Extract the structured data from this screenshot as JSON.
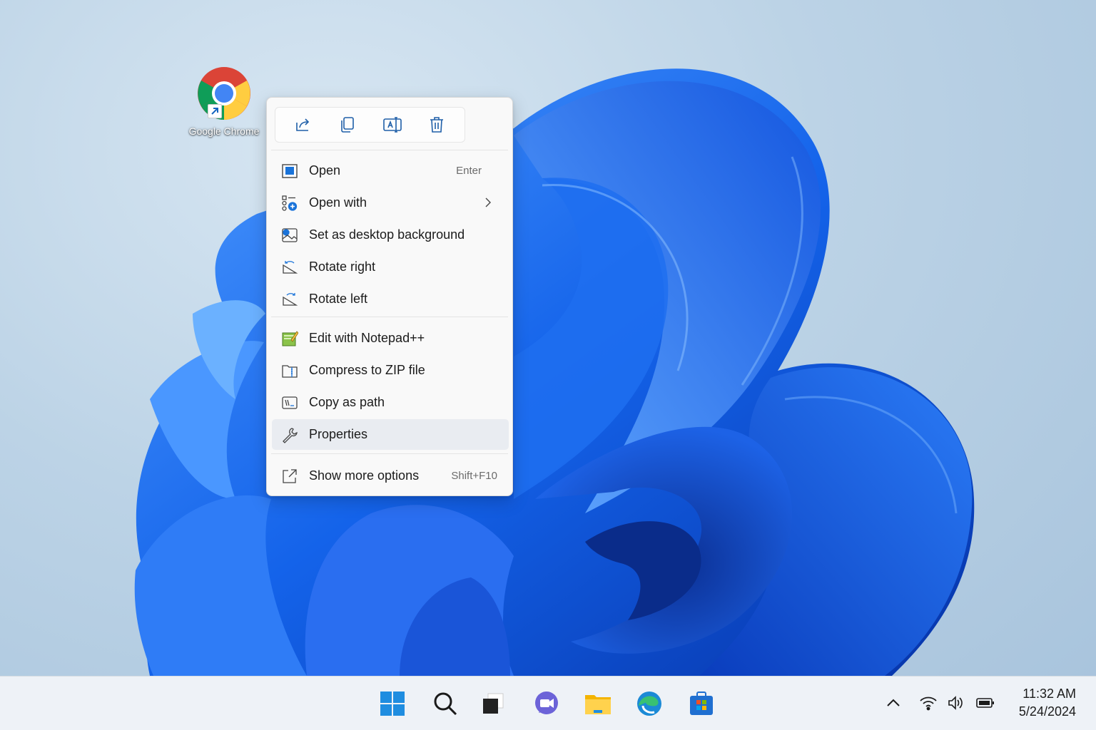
{
  "desktop": {
    "icons": [
      {
        "label": "Google Chrome"
      }
    ]
  },
  "context_menu": {
    "toolbar": [
      {
        "name": "share",
        "icon": "share-icon"
      },
      {
        "name": "copy",
        "icon": "copy-icon"
      },
      {
        "name": "rename",
        "icon": "rename-icon"
      },
      {
        "name": "delete",
        "icon": "trash-icon"
      }
    ],
    "items": [
      {
        "label": "Open",
        "shortcut": "Enter",
        "icon": "open-window-icon"
      },
      {
        "label": "Open with",
        "icon": "open-with-icon",
        "submenu": true
      },
      {
        "label": "Set as desktop background",
        "icon": "image-icon"
      },
      {
        "label": "Rotate right",
        "icon": "rotate-right-icon"
      },
      {
        "label": "Rotate left",
        "icon": "rotate-left-icon"
      },
      {
        "label": "Edit with Notepad++",
        "icon": "notepadpp-icon"
      },
      {
        "label": "Compress to ZIP file",
        "icon": "zip-icon"
      },
      {
        "label": "Copy as path",
        "icon": "copy-path-icon"
      },
      {
        "label": "Properties",
        "icon": "wrench-icon",
        "highlighted": true
      },
      {
        "label": "Show more options",
        "shortcut": "Shift+F10",
        "icon": "external-icon"
      }
    ]
  },
  "taskbar": {
    "apps": [
      "start",
      "search",
      "task-view",
      "teams",
      "file-explorer",
      "edge",
      "store"
    ],
    "tray": [
      "chevron-up",
      "wifi",
      "volume",
      "battery"
    ],
    "time": "11:32 AM",
    "date": "5/24/2024"
  },
  "colors": {
    "accent": "#0067c0",
    "bloom_dark": "#0a3fc4",
    "bloom_light": "#3f8cf5",
    "menu_bg": "#f9f9f9",
    "menu_hover": "#e9ecf1"
  }
}
